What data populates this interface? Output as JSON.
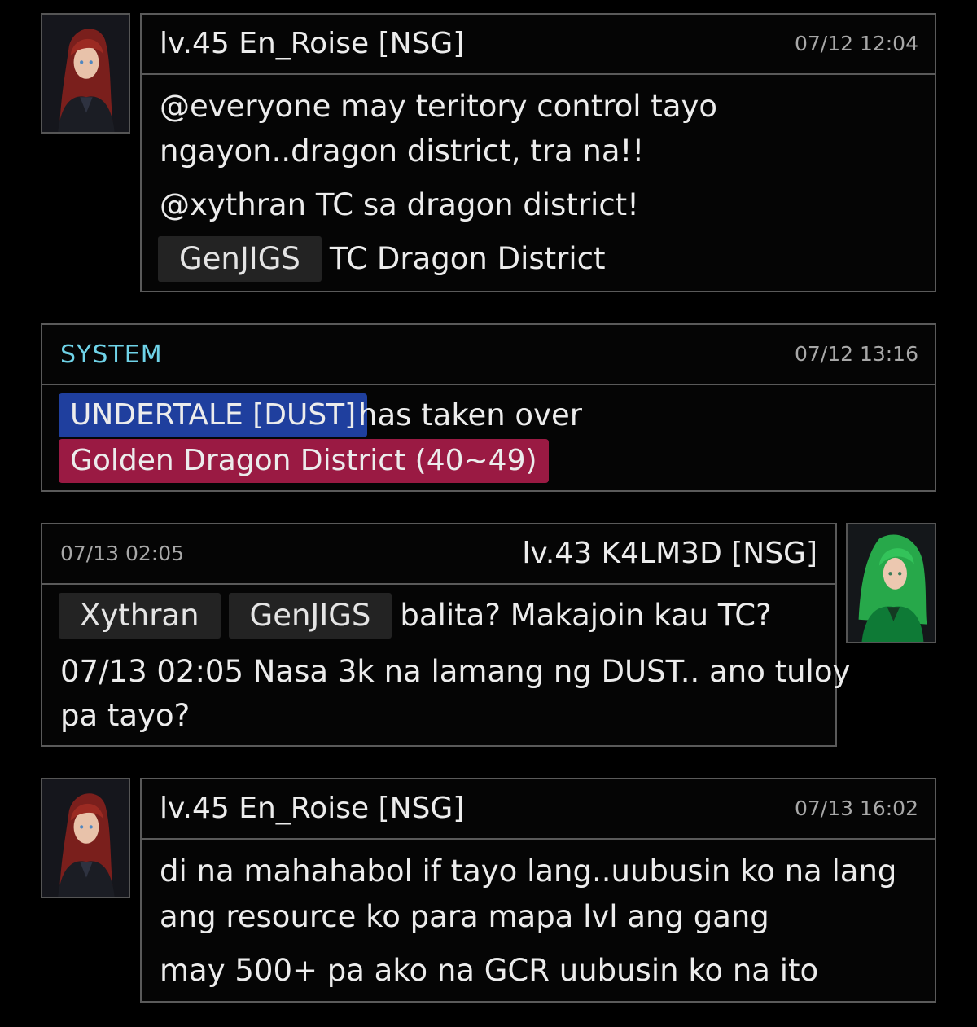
{
  "messages": [
    {
      "author": "lv.45 En_Roise [NSG]",
      "time": "07/12 12:04",
      "avatar": "red-haired-character-avatar",
      "lines": [
        "@everyone may teritory control tayo",
        "ngayon..dragon district, tra na!!",
        "@xythran TC sa dragon district!"
      ],
      "mention_tag": "GenJIGS",
      "mention_text": "TC Dragon District"
    },
    {
      "author": "SYSTEM",
      "time": "07/12 13:16",
      "gang_tag": "UNDERTALE [DUST]",
      "action_text": "has taken over",
      "district_tag": "Golden Dragon District (40~49)"
    },
    {
      "author": "lv.43 K4LM3D [NSG]",
      "time": "07/13 02:05",
      "avatar": "green-haired-character-avatar",
      "mention_tags": [
        "Xythran",
        "GenJIGS"
      ],
      "mention_text": "balita? Makajoin kau TC?",
      "lines": [
        "07/13 02:05 Nasa 3k na lamang ng DUST.. ano tuloy",
        "pa tayo?"
      ]
    },
    {
      "author": "lv.45 En_Roise [NSG]",
      "time": "07/13 16:02",
      "avatar": "red-haired-character-avatar",
      "lines": [
        "di na mahahabol if tayo lang..uubusin ko na lang",
        "ang resource ko para mapa lvl ang gang",
        "may 500+ pa ako na GCR uubusin ko na ito"
      ]
    }
  ],
  "colors": {
    "system_label": "#6fd3e8",
    "gang_tag_bg": "#1f3f9e",
    "district_tag_bg": "#9a1a43",
    "border": "#5a5a5a"
  }
}
